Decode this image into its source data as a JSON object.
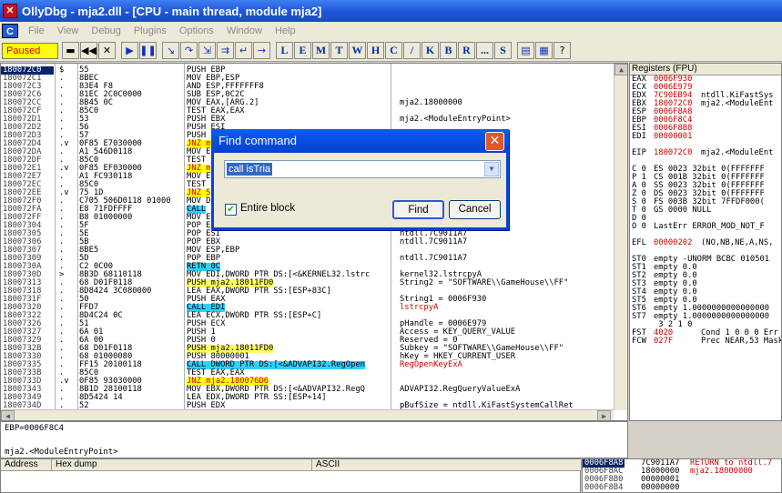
{
  "window": {
    "title": "OllyDbg - mja2.dll - [CPU - main thread, module mja2]",
    "icon_letter": "✕"
  },
  "menu": {
    "c_label": "C",
    "items": [
      "File",
      "View",
      "Debug",
      "Plugins",
      "Options",
      "Window",
      "Help"
    ]
  },
  "toolbar": {
    "status": "Paused",
    "letters": [
      "L",
      "E",
      "M",
      "T",
      "W",
      "H",
      "C",
      "/",
      "K",
      "B",
      "R",
      "...",
      "S"
    ]
  },
  "disasm": [
    {
      "a": "180072C0",
      "m": "$",
      "h": "55",
      "d": "PUSH EBP",
      "c": ""
    },
    {
      "a": "180072C1",
      "m": ".",
      "h": "8BEC",
      "d": "MOV EBP,ESP",
      "c": ""
    },
    {
      "a": "180072C3",
      "m": ".",
      "h": "83E4 F8",
      "d": "AND ESP,FFFFFFF8",
      "c": ""
    },
    {
      "a": "180072C6",
      "m": ".",
      "h": "81EC 2C0C0000",
      "d": "SUB ESP,0C2C",
      "c": ""
    },
    {
      "a": "180072CC",
      "m": ".",
      "h": "8B45 0C",
      "d": "MOV EAX,[ARG.2]",
      "c": "mja2.18000000"
    },
    {
      "a": "180072CF",
      "m": ".",
      "h": "85C0",
      "d": "TEST EAX,EAX",
      "c": ""
    },
    {
      "a": "180072D1",
      "m": ".",
      "h": "53",
      "d": "PUSH EBX",
      "c": "mja2.<ModuleEntryPoint>"
    },
    {
      "a": "180072D2",
      "m": ".",
      "h": "56",
      "d": "PUSH ESI",
      "c": ""
    },
    {
      "a": "180072D3",
      "m": ".",
      "h": "57",
      "d": "PUSH EDI",
      "c": ""
    },
    {
      "a": "180072D4",
      "m": ".v",
      "h": "0F85 E7030000",
      "d": "JNZ mja2",
      "c": ""
    },
    {
      "a": "180072DA",
      "m": ".",
      "h": "A1 546D0118",
      "d": "MOV E",
      "c": ""
    },
    {
      "a": "180072DF",
      "m": ".",
      "h": "85C0",
      "d": "TEST",
      "c": ""
    },
    {
      "a": "180072E1",
      "m": ".v",
      "h": "0F85 EF030000",
      "d": "JNZ m",
      "c": ""
    },
    {
      "a": "180072E7",
      "m": ".",
      "h": "A1 FC930118",
      "d": "MOV E",
      "c": ""
    },
    {
      "a": "180072EC",
      "m": ".",
      "h": "85C0",
      "d": "TEST",
      "c": ""
    },
    {
      "a": "180072EE",
      "m": ".v",
      "h": "75 1D",
      "d": "JNZ S",
      "c": ""
    },
    {
      "a": "180072F0",
      "m": ".",
      "h": "C705 506D0118 01000",
      "d": "MOV D",
      "c": ""
    },
    {
      "a": "180072FA",
      "m": ".",
      "h": "E8 71FDFFFF",
      "d": "CALL",
      "c": ""
    },
    {
      "a": "180072FF",
      "m": ".",
      "h": "B8 01000000",
      "d": "MOV E",
      "c": ""
    },
    {
      "a": "18007304",
      "m": ".",
      "h": "5F",
      "d": "POP E",
      "c": ""
    },
    {
      "a": "18007305",
      "m": ".",
      "h": "5E",
      "d": "POP ESI",
      "c": "ntdll.7C9011A7"
    },
    {
      "a": "18007306",
      "m": ".",
      "h": "5B",
      "d": "POP EBX",
      "c": "ntdll.7C9011A7"
    },
    {
      "a": "18007307",
      "m": ".",
      "h": "8BE5",
      "d": "MOV ESP,EBP",
      "c": ""
    },
    {
      "a": "18007309",
      "m": ".",
      "h": "5D",
      "d": "POP EBP",
      "c": "ntdll.7C9011A7"
    },
    {
      "a": "1800730A",
      "m": ".",
      "h": "C2 0C00",
      "d": "RETN 0C",
      "c": ""
    },
    {
      "a": "1800730D",
      "m": ">",
      "h": "8B3D 68110118",
      "d": "MOV EDI,DWORD PTR DS:[<&KERNEL32.lstrc",
      "c": "kernel32.lstrcpyA"
    },
    {
      "a": "18007313",
      "m": ".",
      "h": "68 D01F0118",
      "d": "PUSH mja2.18011FD0",
      "c": "String2 = \"SOFTWARE\\\\GameHouse\\\\FF\""
    },
    {
      "a": "18007318",
      "m": ".",
      "h": "8D8424 3C080000",
      "d": "LEA EAX,DWORD PTR SS:[ESP+83C]",
      "c": ""
    },
    {
      "a": "1800731F",
      "m": ".",
      "h": "50",
      "d": "PUSH EAX",
      "c": "String1 = 0006F930"
    },
    {
      "a": "18007320",
      "m": ".",
      "h": "FFD7",
      "d": "CALL EDI",
      "c": "lstrcpyA"
    },
    {
      "a": "18007322",
      "m": ".",
      "h": "8D4C24 0C",
      "d": "LEA ECX,DWORD PTR SS:[ESP+C]",
      "c": ""
    },
    {
      "a": "18007326",
      "m": ".",
      "h": "51",
      "d": "PUSH ECX",
      "c": "pHandle = 0006E979"
    },
    {
      "a": "18007327",
      "m": ".",
      "h": "6A 01",
      "d": "PUSH 1",
      "c": "Access = KEY_QUERY_VALUE"
    },
    {
      "a": "18007329",
      "m": ".",
      "h": "6A 00",
      "d": "PUSH 0",
      "c": "Reserved = 0"
    },
    {
      "a": "1800732B",
      "m": ".",
      "h": "68 D01F0118",
      "d": "PUSH mja2.18011FD0",
      "c": "Subkey = \"SOFTWARE\\\\GameHouse\\\\FF\""
    },
    {
      "a": "18007330",
      "m": ".",
      "h": "68 01000080",
      "d": "PUSH 80000001",
      "c": "hKey = HKEY_CURRENT_USER"
    },
    {
      "a": "18007335",
      "m": ".",
      "h": "FF15 20100118",
      "d": "CALL DWORD PTR DS:[<&ADVAPI32.RegOpen",
      "c": "RegOpenKeyExA"
    },
    {
      "a": "1800733B",
      "m": ".",
      "h": "85C0",
      "d": "TEST EAX,EAX",
      "c": ""
    },
    {
      "a": "1800733D",
      "m": ".v",
      "h": "0F85 93030000",
      "d": "JNZ mja2.180076D6",
      "c": ""
    },
    {
      "a": "18007343",
      "m": ".",
      "h": "8B1D 28100118",
      "d": "MOV EBX,DWORD PTR DS:[<&ADVAPI32.RegQ",
      "c": "ADVAPI32.RegQueryValueExA"
    },
    {
      "a": "18007349",
      "m": ".",
      "h": "8D5424 14",
      "d": "LEA EDX,DWORD PTR SS:[ESP+14]",
      "c": ""
    },
    {
      "a": "1800734D",
      "m": ".",
      "h": "52",
      "d": "PUSH EDX",
      "c": "pBufSize = ntdll.KiFastSystemCallRet"
    }
  ],
  "registers": {
    "header": "Registers (FPU)",
    "rows": [
      {
        "n": "EAX",
        "v": "0006F930",
        "": ""
      },
      {
        "n": "ECX",
        "v": "0006E979"
      },
      {
        "n": "EDX",
        "v": "7C90EB94",
        "t": "ntdll.KiFastSys"
      },
      {
        "n": "EBX",
        "v": "180072C0",
        "t": "mja2.<ModuleEnt"
      },
      {
        "n": "ESP",
        "v": "0006F8A8"
      },
      {
        "n": "EBP",
        "v": "0006F8C4"
      },
      {
        "n": "ESI",
        "v": "0006F8B8"
      },
      {
        "n": "EDI",
        "v": "00000001"
      },
      {
        "n": "",
        "v": ""
      },
      {
        "n": "EIP",
        "v": "180072C0",
        "t": "mja2.<ModuleEnt"
      },
      {
        "n": "",
        "v": ""
      },
      {
        "n": "C 0",
        "v": "",
        "t": "ES 0023 32bit 0(FFFFFFF"
      },
      {
        "n": "P 1",
        "v": "",
        "t": "CS 001B 32bit 0(FFFFFFF"
      },
      {
        "n": "A 0",
        "v": "",
        "t": "SS 0023 32bit 0(FFFFFFF"
      },
      {
        "n": "Z 0",
        "v": "",
        "t": "DS 0023 32bit 0(FFFFFFF"
      },
      {
        "n": "S 0",
        "v": "",
        "t": "FS 003B 32bit 7FFDF000("
      },
      {
        "n": "T 0",
        "v": "",
        "t": "GS 0000 NULL"
      },
      {
        "n": "D 0",
        "v": ""
      },
      {
        "n": "O 0",
        "v": "",
        "t": "LastErr ERROR_MOD_NOT_F"
      },
      {
        "n": "",
        "v": ""
      },
      {
        "n": "EFL",
        "v": "00000202",
        "t": "(NO,NB,NE,A,NS,"
      },
      {
        "n": "",
        "v": ""
      },
      {
        "n": "ST0",
        "v": "",
        "t": "empty -UNORM BCBC 010501"
      },
      {
        "n": "ST1",
        "v": "",
        "t": "empty 0.0"
      },
      {
        "n": "ST2",
        "v": "",
        "t": "empty 0.0"
      },
      {
        "n": "ST3",
        "v": "",
        "t": "empty 0.0"
      },
      {
        "n": "ST4",
        "v": "",
        "t": "empty 0.0"
      },
      {
        "n": "ST5",
        "v": "",
        "t": "empty 0.0"
      },
      {
        "n": "ST6",
        "v": "",
        "t": "empty 1.0000000000000000"
      },
      {
        "n": "ST7",
        "v": "",
        "t": "empty 1.0000000000000000"
      },
      {
        "n": "",
        "v": "",
        "t": "        3 2 1 0"
      },
      {
        "n": "FST",
        "v": "4020",
        "t": "Cond 1 0 0 0  Err"
      },
      {
        "n": "FCW",
        "v": "027F",
        "t": "Prec NEAR,53  Mask"
      }
    ]
  },
  "info": {
    "line1": "EBP=0006F8C4",
    "line2": "mja2.<ModuleEntryPoint>"
  },
  "dump": {
    "col_address": "Address",
    "col_hex": "Hex dump",
    "col_ascii": "ASCII"
  },
  "stack": [
    {
      "a": "0006F8A8",
      "v": "7C9011A7",
      "c": "RETURN to ntdll.7"
    },
    {
      "a": "0006F8AC",
      "v": "18000000",
      "c": "mja2.18000000"
    },
    {
      "a": "0006F8B0",
      "v": "00000001",
      "c": ""
    },
    {
      "a": "0006F8B4",
      "v": "00000000",
      "c": ""
    }
  ],
  "dialog": {
    "title": "Find command",
    "input_value": "call isTria",
    "checkbox_label": "Entire block",
    "checkbox_checked": true,
    "find_label": "Find",
    "cancel_label": "Cancel"
  }
}
